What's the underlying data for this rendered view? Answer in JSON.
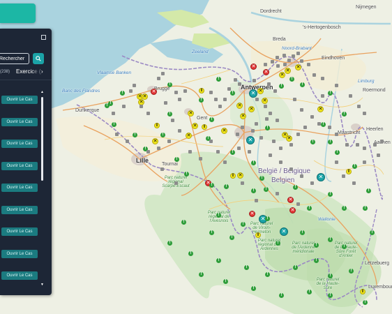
{
  "map": {
    "places": [
      {
        "name": "Dordrecht",
        "cls": ""
      },
      {
        "name": "Nijmegen",
        "cls": ""
      },
      {
        "name": "'s-Hertogenbosch",
        "cls": ""
      },
      {
        "name": "Breda",
        "cls": ""
      },
      {
        "name": "Noord-Brabant",
        "cls": "blue"
      },
      {
        "name": "Eindhoven",
        "cls": ""
      },
      {
        "name": "Zeeland",
        "cls": "blue"
      },
      {
        "name": "Limburg",
        "cls": "blue"
      },
      {
        "name": "Roermond",
        "cls": ""
      },
      {
        "name": "Vlaamse Banken",
        "cls": "blue"
      },
      {
        "name": "Banc des Flandres",
        "cls": "blue"
      },
      {
        "name": "Antwerpen",
        "cls": "big"
      },
      {
        "name": "Brugge",
        "cls": ""
      },
      {
        "name": "Dunkerque",
        "cls": ""
      },
      {
        "name": "Gent",
        "cls": ""
      },
      {
        "name": "Lille",
        "cls": "big"
      },
      {
        "name": "Tournai",
        "cls": ""
      },
      {
        "name": "Maastricht",
        "cls": ""
      },
      {
        "name": "Heerlen",
        "cls": ""
      },
      {
        "name": "Aachen",
        "cls": ""
      },
      {
        "name": "België / Belgique",
        "cls": "country"
      },
      {
        "name": "Belgien",
        "cls": "country"
      },
      {
        "name": "Wallonie",
        "cls": "blue"
      },
      {
        "name": "Parc naturel régional Scarpe-Escaut",
        "cls": "green"
      },
      {
        "name": "Parc naturel régional de l'Avesnois",
        "cls": "green"
      },
      {
        "name": "Parc naturel de Viroin-Hermeton",
        "cls": "green"
      },
      {
        "name": "Parc naturel régional des Ardennes",
        "cls": "green"
      },
      {
        "name": "Parc naturel de l'Ardenne méridionale",
        "cls": "green"
      },
      {
        "name": "Parc naturel de la Haute-Sûre Forêt d'Anlier",
        "cls": "green"
      },
      {
        "name": "Lëtzebuerg",
        "cls": ""
      },
      {
        "name": "Parc naturel de la Haute-Sûre",
        "cls": "green"
      },
      {
        "name": "Luxembourg",
        "cls": ""
      }
    ]
  },
  "ui": {
    "search": {
      "placeholder": "Rechercher"
    },
    "tabs": {
      "count_text": "(238)",
      "active_label": "Exercice",
      "active_tail": "(",
      "next_arrow": "›"
    },
    "list": {
      "buttons": [
        {
          "label": "Ouvrir Le Cas"
        },
        {
          "label": "Ouvrir Le Cas"
        },
        {
          "label": "Ouvrir Le Cas"
        },
        {
          "label": "Ouvrir Le Cas"
        },
        {
          "label": "Ouvrir Le Cas"
        },
        {
          "label": "Ouvrir Le Cas"
        },
        {
          "label": "Ouvrir Le Cas"
        },
        {
          "label": "Ouvrir Le Cas"
        },
        {
          "label": "Ouvrir Le Cas"
        }
      ],
      "scroll_up": "▲",
      "scroll_down": "▼"
    },
    "colors": {
      "panel": "#1d2636",
      "accent": "#1ba3a7",
      "top_button": "#1cb7a5",
      "marker_yellow": "#f1e61a",
      "marker_red": "#e23434",
      "marker_green": "#2e9d3a"
    }
  }
}
